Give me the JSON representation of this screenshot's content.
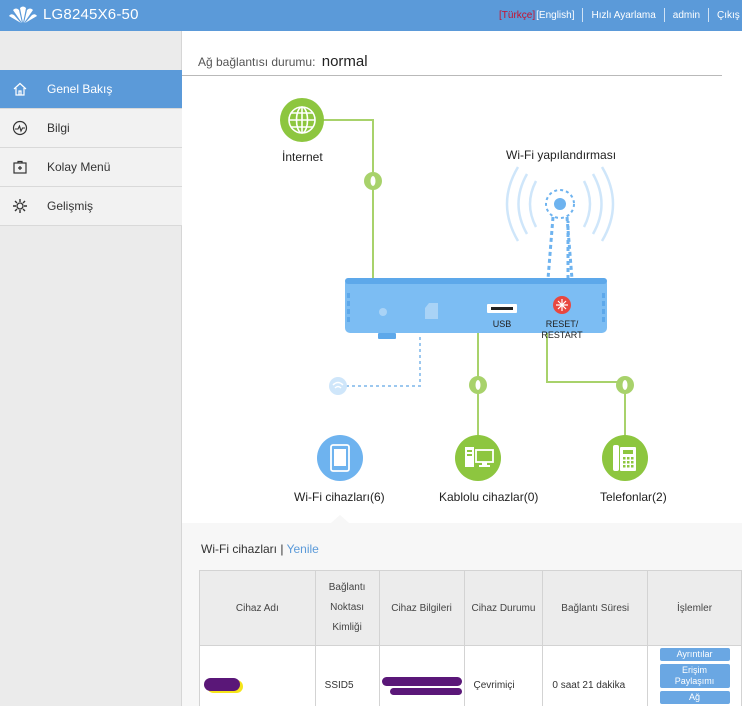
{
  "header": {
    "logo_text": "LG8245X6-50",
    "lang_current": "[Türkçe]",
    "lang_other": "[English]",
    "quick_setup": "Hızlı Ayarlama",
    "user": "admin",
    "logout": "Çıkış yap"
  },
  "sidebar": {
    "items": [
      {
        "label": "Genel Bakış",
        "icon": "home-icon",
        "active": true
      },
      {
        "label": "Bilgi",
        "icon": "pulse-icon",
        "active": false
      },
      {
        "label": "Kolay Menü",
        "icon": "toolbox-icon",
        "active": false
      },
      {
        "label": "Gelişmiş",
        "icon": "gear-icon",
        "active": false
      }
    ]
  },
  "status": {
    "label": "Ağ bağlantısı durumu:",
    "value": "normal"
  },
  "diagram": {
    "internet_label": "İnternet",
    "wifi_config_label": "Wi-Fi yapılandırması",
    "usb_label": "USB",
    "reset_label_1": "RESET/",
    "reset_label_2": "RESTART",
    "wifi_devices_label": "Wi-Fi cihazları(6)",
    "wired_devices_label": "Kablolu cihazlar(0)",
    "phones_label": "Telefonlar(2)"
  },
  "wifi_section": {
    "title": "Wi-Fi cihazları |",
    "refresh": "Yenile"
  },
  "table": {
    "headers": {
      "name": "Cihaz Adı",
      "access_point_1": "Bağlantı",
      "access_point_2": "Noktası",
      "access_point_3": "Kimliği",
      "info": "Cihaz Bilgileri",
      "state": "Cihaz Durumu",
      "duration": "Bağlantı Süresi",
      "actions": "İşlemler"
    },
    "rows": [
      {
        "ssid": "SSID5",
        "state": "Çevrimiçi",
        "duration": "0 saat 21 dakika",
        "btn_details": "Ayrıntılar",
        "btn_access_1": "Erişim",
        "btn_access_2": "Paylaşımı",
        "btn_network": "Ağ"
      }
    ]
  },
  "colors": {
    "accent": "#5b9ad9",
    "green": "#8dc63f",
    "router": "#6eb3ef",
    "reset": "#e8473f"
  }
}
